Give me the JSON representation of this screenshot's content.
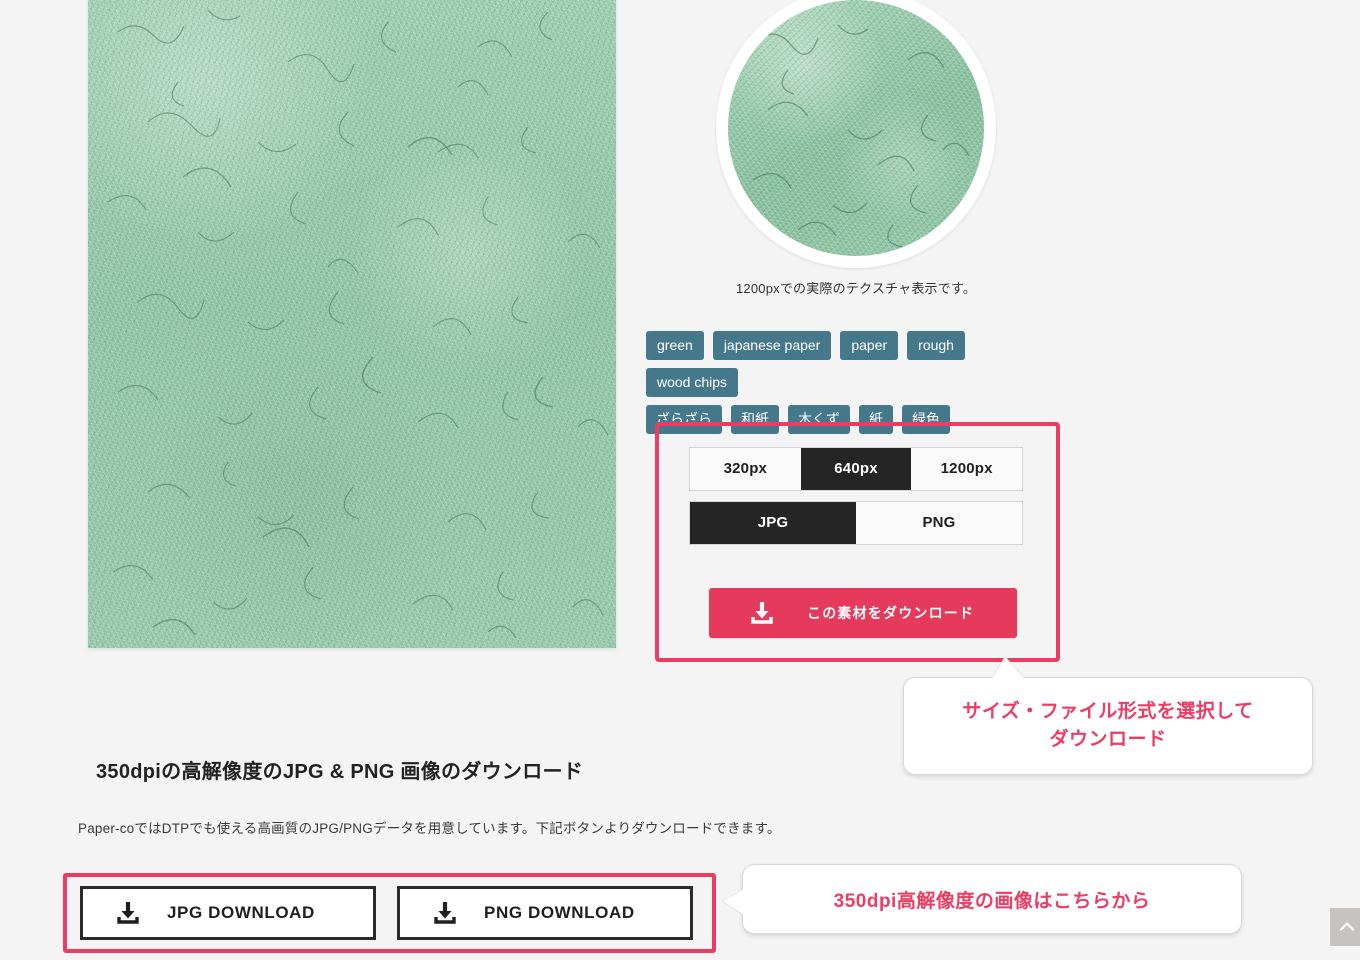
{
  "preview": {
    "caption": "1200pxでの実際のテクスチャ表示です。",
    "texture_color": "#92c6a7"
  },
  "tags": {
    "row1": [
      {
        "label": "green"
      },
      {
        "label": "japanese paper"
      },
      {
        "label": "paper"
      },
      {
        "label": "rough"
      },
      {
        "label": "wood chips"
      }
    ],
    "row2": [
      {
        "label": "ざらざら"
      },
      {
        "label": "和紙"
      },
      {
        "label": "木くず"
      },
      {
        "label": "紙"
      },
      {
        "label": "緑色"
      }
    ],
    "chip_color": "#45788b"
  },
  "selector": {
    "sizes": [
      {
        "label": "320px",
        "active": false
      },
      {
        "label": "640px",
        "active": true
      },
      {
        "label": "1200px",
        "active": false
      }
    ],
    "formats": [
      {
        "label": "JPG",
        "active": true
      },
      {
        "label": "PNG",
        "active": false
      }
    ],
    "download_label": "この素材をダウンロード",
    "download_icon": "download-icon",
    "accent_color": "#e63a5d",
    "highlight_color": "#ec3c63"
  },
  "callouts": {
    "selector_hint_line1": "サイズ・ファイル形式を選択して",
    "selector_hint_line2": "ダウンロード",
    "hires_hint": "350dpi高解像度の画像はこちらから",
    "text_color": "#ec3c63"
  },
  "hires_section": {
    "title": "350dpiの高解像度のJPG & PNG 画像のダウンロード",
    "description": "Paper-coではDTPでも使える高画質のJPG/PNGデータを用意しています。下記ボタンよりダウンロードできます。",
    "buttons": [
      {
        "label": "JPG DOWNLOAD",
        "icon": "download-icon"
      },
      {
        "label": "PNG DOWNLOAD",
        "icon": "download-icon"
      }
    ]
  },
  "scroll_top": {
    "icon": "chevron-up-icon",
    "color": "#c6c3c1"
  }
}
